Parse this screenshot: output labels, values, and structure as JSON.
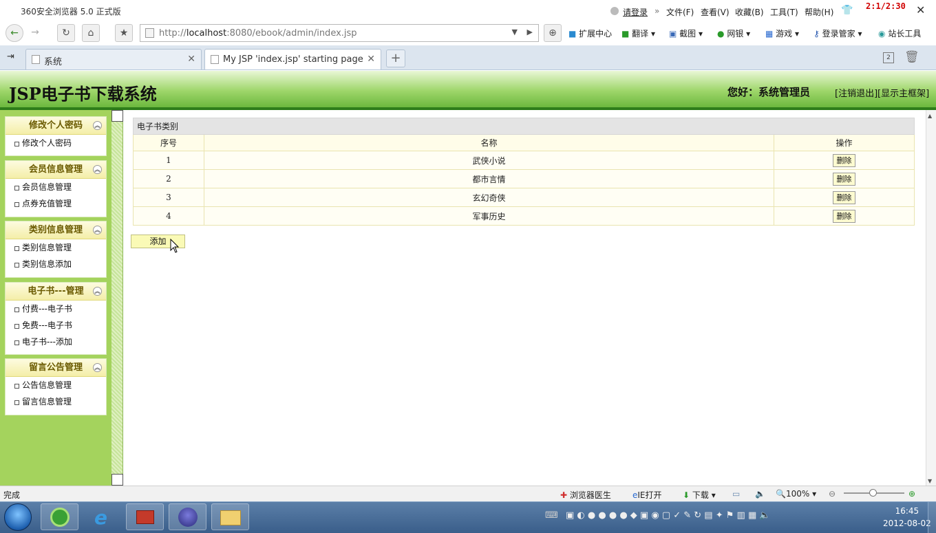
{
  "browser": {
    "title": "360安全浏览器 5.0 正式版",
    "login": "请登录",
    "menus": [
      "文件(F)",
      "查看(V)",
      "收藏(B)",
      "工具(T)",
      "帮助(H)"
    ],
    "corner_text": "2:1/2:30",
    "url_prefix": "http://",
    "url_host": "localhost",
    "url_rest": ":8080/ebook/admin/index.jsp",
    "toolbar_items": [
      "扩展中心",
      "翻译",
      "截图",
      "网银",
      "游戏",
      "登录管家",
      "站长工具"
    ],
    "tabs": [
      {
        "label": "系统",
        "active": false
      },
      {
        "label": "My JSP 'index.jsp' starting page",
        "active": true
      }
    ]
  },
  "header": {
    "system_name": "JSP电子书下载系统",
    "greeting": "您好：系统管理员",
    "logout": "[注销退出]",
    "show_frame": "[显示主框架]"
  },
  "sidebar": {
    "groups": [
      {
        "title": "修改个人密码",
        "items": [
          "修改个人密码"
        ]
      },
      {
        "title": "会员信息管理",
        "items": [
          "会员信息管理",
          "点券充值管理"
        ]
      },
      {
        "title": "类别信息管理",
        "items": [
          "类别信息管理",
          "类别信息添加"
        ]
      },
      {
        "title": "电子书---管理",
        "items": [
          "付费---电子书",
          "免费---电子书",
          "电子书---添加"
        ]
      },
      {
        "title": "留言公告管理",
        "items": [
          "公告信息管理",
          "留言信息管理"
        ]
      }
    ]
  },
  "main": {
    "caption": "电子书类别",
    "columns": [
      "序号",
      "名称",
      "操作"
    ],
    "rows": [
      {
        "no": "1",
        "name": "武侠小说",
        "action": "删除"
      },
      {
        "no": "2",
        "name": "都市言情",
        "action": "删除"
      },
      {
        "no": "3",
        "name": "玄幻奇侠",
        "action": "删除"
      },
      {
        "no": "4",
        "name": "军事历史",
        "action": "删除"
      }
    ],
    "add_label": "添加"
  },
  "statusbar": {
    "status": "完成",
    "doctor": "浏览器医生",
    "ie_open": "IE打开",
    "download": "下载",
    "zoom": "100%"
  },
  "taskbar": {
    "time": "16:45",
    "date": "2012-08-02"
  }
}
